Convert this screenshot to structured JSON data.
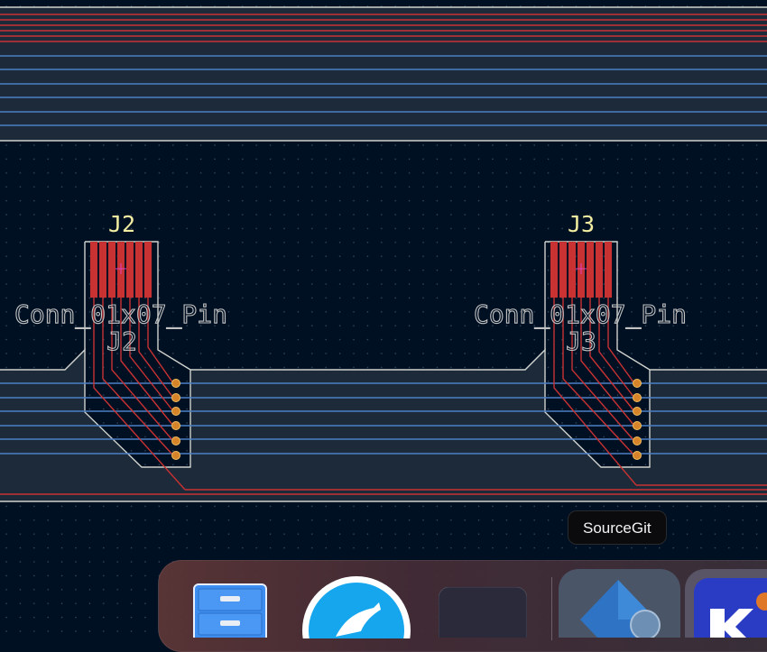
{
  "board": {
    "background_color": "#001023",
    "front_copper_color": "#c83232",
    "back_copper_color": "#4d7fc4",
    "edge_color": "#d0d2cd",
    "silkscreen_color": "#f2eda1",
    "fab_text_color": "#c2c2c2",
    "pad_color": "#d6842a"
  },
  "components": [
    {
      "reference": "J2",
      "value": "Conn_01x07_Pin",
      "fab_reference": "J2"
    },
    {
      "reference": "J3",
      "value": "Conn_01x07_Pin",
      "fab_reference": "J3"
    }
  ],
  "tooltip": {
    "text": "SourceGit"
  },
  "dock": {
    "items": [
      {
        "name": "finder-files-icon"
      },
      {
        "name": "kiwi-bird-icon"
      },
      {
        "name": "dark-app-icon"
      },
      {
        "name": "sourcegit-icon"
      },
      {
        "name": "kicad-icon"
      }
    ]
  }
}
